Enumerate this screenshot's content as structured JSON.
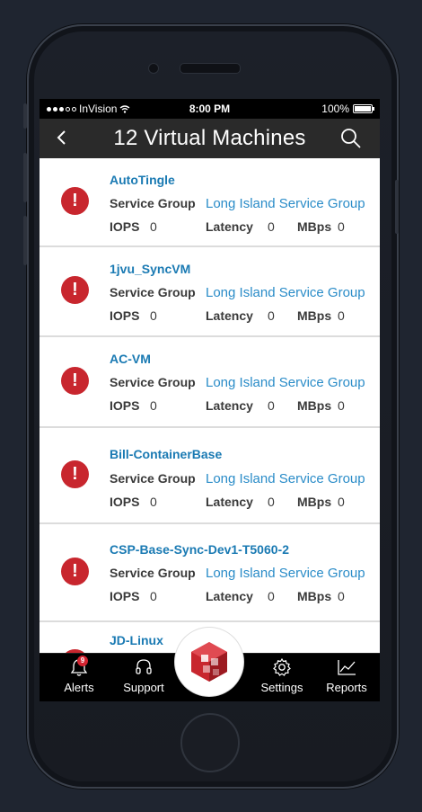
{
  "status": {
    "carrier": "InVision",
    "time": "8:00 PM",
    "battery": "100%"
  },
  "nav": {
    "title": "12 Virtual Machines"
  },
  "labels": {
    "service_group": "Service Group",
    "iops": "IOPS",
    "latency": "Latency",
    "mbps": "MBps"
  },
  "vms": [
    {
      "name": "AutoTingle",
      "service_group": "Long Island Service Group",
      "iops": "0",
      "latency": "0",
      "mbps": "0"
    },
    {
      "name": "1jvu_SyncVM",
      "service_group": "Long Island Service Group",
      "iops": "0",
      "latency": "0",
      "mbps": "0"
    },
    {
      "name": "AC-VM",
      "service_group": "Long Island Service Group",
      "iops": "0",
      "latency": "0",
      "mbps": "0"
    },
    {
      "name": "Bill-ContainerBase",
      "service_group": "Long Island Service Group",
      "iops": "0",
      "latency": "0",
      "mbps": "0"
    },
    {
      "name": "CSP-Base-Sync-Dev1-T5060-2",
      "service_group": "Long Island Service Group",
      "iops": "0",
      "latency": "0",
      "mbps": "0"
    },
    {
      "name": "JD-Linux"
    }
  ],
  "tabbar": {
    "alerts": "Alerts",
    "alerts_badge": "9",
    "support": "Support",
    "settings": "Settings",
    "reports": "Reports"
  },
  "colors": {
    "alert": "#c8262e",
    "link": "#2a8cc8",
    "brand": "#c8262e"
  }
}
